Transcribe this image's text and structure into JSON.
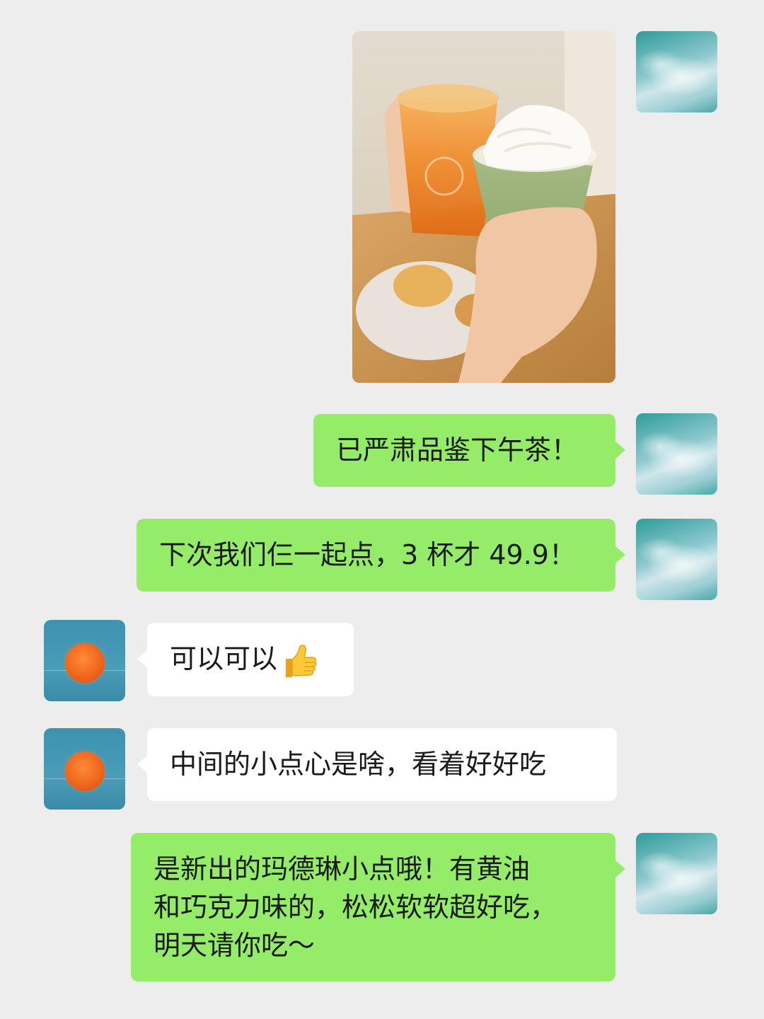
{
  "messages": [
    {
      "side": "right",
      "type": "image"
    },
    {
      "side": "right",
      "type": "text",
      "text": "已严肃品鉴下午茶！"
    },
    {
      "side": "right",
      "type": "text",
      "text": "下次我们仨一起点，3 杯才 49.9！"
    },
    {
      "side": "left",
      "type": "text",
      "text": "可以可以",
      "emoji": "thumbs-up-icon"
    },
    {
      "side": "left",
      "type": "text",
      "text": "中间的小点心是啥，看着好好吃"
    },
    {
      "side": "right",
      "type": "text",
      "lines": [
        "是新出的玛德琳小点哦！有黄油",
        "和巧克力味的，松松软软超好吃，",
        "明天请你吃～"
      ]
    }
  ],
  "colors": {
    "background": "#ededed",
    "self_bubble": "#95ec69",
    "other_bubble": "#ffffff"
  }
}
